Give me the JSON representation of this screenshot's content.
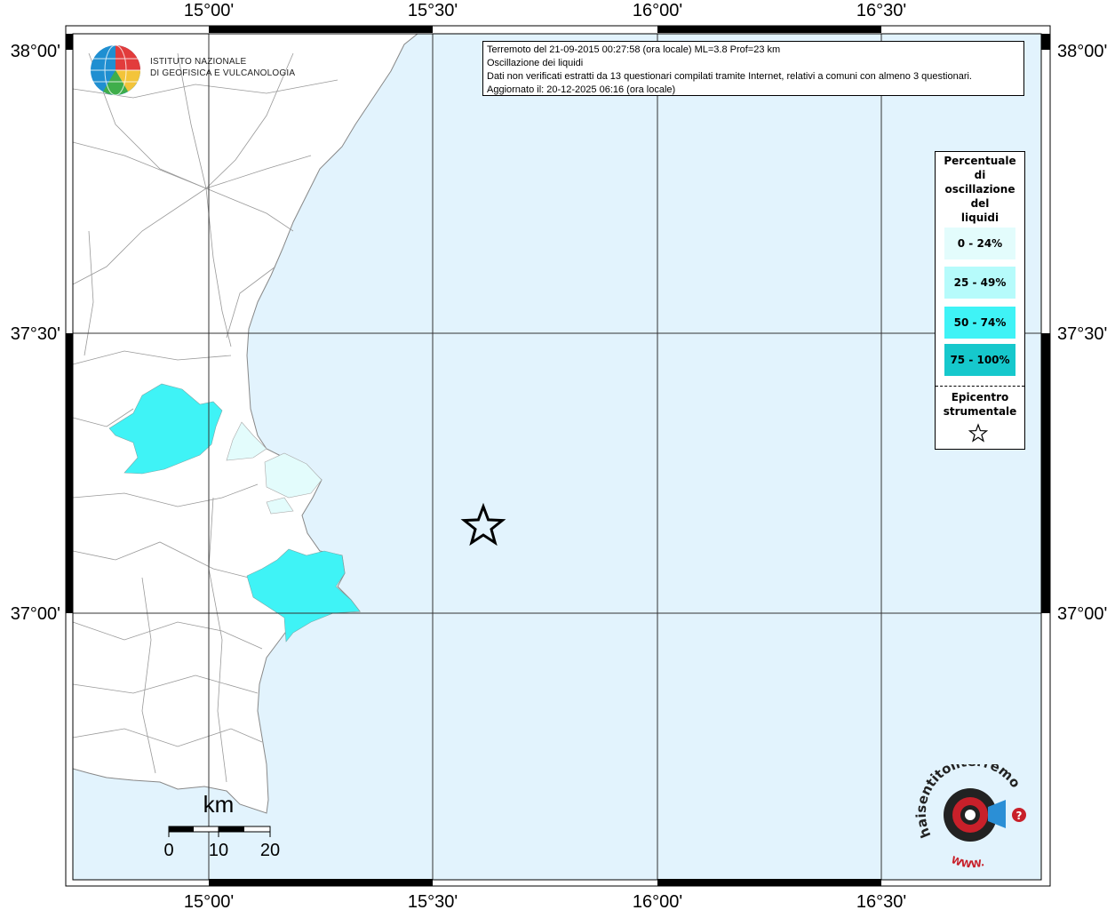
{
  "header": {
    "title_line": "Terremoto del 21-09-2015 00:27:58 (ora locale) ML=3.8 Prof=23 km",
    "subtitle": "Oscillazione dei liquidi",
    "note": "Dati non verificati estratti da 13 questionari compilati tramite Internet, relativi a comuni con almeno 3 questionari.",
    "updated": "Aggiornato il: 20-12-2025 06:16 (ora locale)"
  },
  "institute": {
    "line1": "ISTITUTO NAZIONALE",
    "line2": "DI GEOFISICA E VULCANOLOGIA"
  },
  "axes": {
    "lon_labels": [
      "15°00'",
      "15°30'",
      "16°00'",
      "16°30'"
    ],
    "lat_labels": [
      "38°00'",
      "37°30'",
      "37°00'"
    ]
  },
  "legend": {
    "title_lines": [
      "Percentuale",
      "di",
      "oscillazione",
      "del",
      "liquidi"
    ],
    "items": [
      {
        "label": "0 - 24%",
        "color": "#e3fcfc"
      },
      {
        "label": "25 - 49%",
        "color": "#b6fbfb"
      },
      {
        "label": "50 - 74%",
        "color": "#3ff3f6"
      },
      {
        "label": "75 - 100%",
        "color": "#16c8cc"
      }
    ],
    "epicenter_lines": [
      "Epicentro",
      "strumentale"
    ]
  },
  "scale": {
    "unit": "km",
    "labels": [
      "0",
      "10",
      "20"
    ]
  },
  "watermark": {
    "brand": "haisentitoilterremoto.it",
    "web": "WWW.",
    "symbol": "?"
  },
  "colors": {
    "sea": "#e2f3fd",
    "land": "#ffffff"
  }
}
